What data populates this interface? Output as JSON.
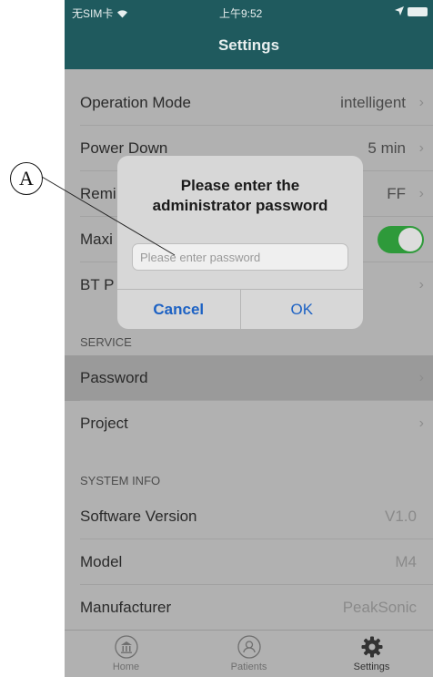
{
  "annotation": {
    "label": "A"
  },
  "status_bar": {
    "carrier": "无SIM卡",
    "time": "上午9:52"
  },
  "nav": {
    "title": "Settings"
  },
  "rows": {
    "operation_mode": {
      "label": "Operation Mode",
      "value": "intelligent"
    },
    "power_down": {
      "label": "Power Down",
      "value": "5 min"
    },
    "remind": {
      "label": "Remi",
      "value": "FF"
    },
    "maxi": {
      "label": "Maxi",
      "toggle_on": true
    },
    "bt": {
      "label": "BT P"
    }
  },
  "service": {
    "header": "SERVICE",
    "items": [
      {
        "label": "Password"
      },
      {
        "label": "Project"
      }
    ]
  },
  "system_info": {
    "header": "SYSTEM INFO",
    "items": [
      {
        "label": "Software Version",
        "value": "V1.0"
      },
      {
        "label": "Model",
        "value": "M4"
      },
      {
        "label": "Manufacturer",
        "value": "PeakSonic"
      }
    ]
  },
  "tabs": [
    {
      "label": "Home",
      "icon": "bank-icon"
    },
    {
      "label": "Patients",
      "icon": "person-icon"
    },
    {
      "label": "Settings",
      "icon": "gear-icon"
    }
  ],
  "dialog": {
    "title": "Please enter the administrator password",
    "placeholder": "Please enter password",
    "value": "",
    "cancel_label": "Cancel",
    "ok_label": "OK"
  },
  "colors": {
    "nav_bg": "#1f5a5e",
    "toggle_on": "#2e9a3a",
    "dialog_button": "#1d62c4",
    "overlay_bg": "#b1b1b1"
  }
}
